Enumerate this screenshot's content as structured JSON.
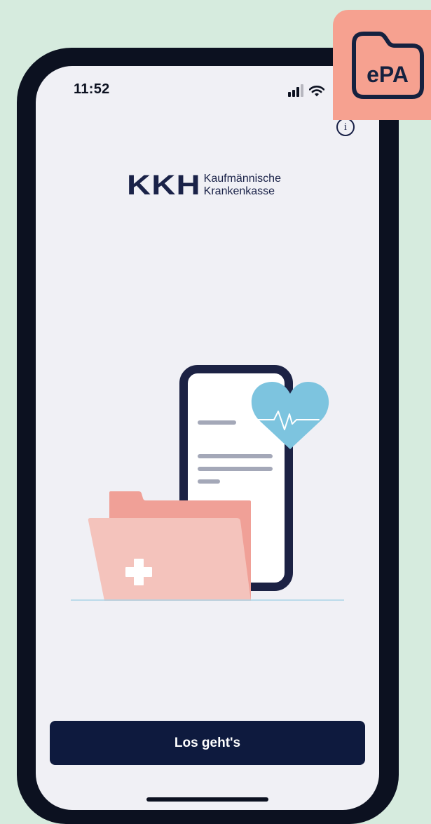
{
  "status_bar": {
    "time": "11:52",
    "icons": [
      "signal-icon",
      "wifi-icon",
      "battery-icon"
    ]
  },
  "header": {
    "info_icon": "info-icon",
    "info_glyph": "i"
  },
  "logo": {
    "mark": "KKH",
    "line1": "Kaufmännische",
    "line2": "Krankenkasse"
  },
  "illustration": {
    "icons": [
      "phone-icon",
      "heart-pulse-icon",
      "medical-folder-icon"
    ]
  },
  "cta": {
    "label": "Los geht's"
  },
  "badge": {
    "label": "ePA",
    "icon": "folder-icon"
  },
  "colors": {
    "background": "#d6ebde",
    "phone_frame": "#0c1120",
    "screen": "#f0f0f5",
    "brand_navy": "#1a2248",
    "button": "#0e1a3e",
    "badge": "#f6a190",
    "heart": "#7dc4df",
    "folder_back": "#f0a097",
    "folder_front": "#f4c3bc"
  }
}
